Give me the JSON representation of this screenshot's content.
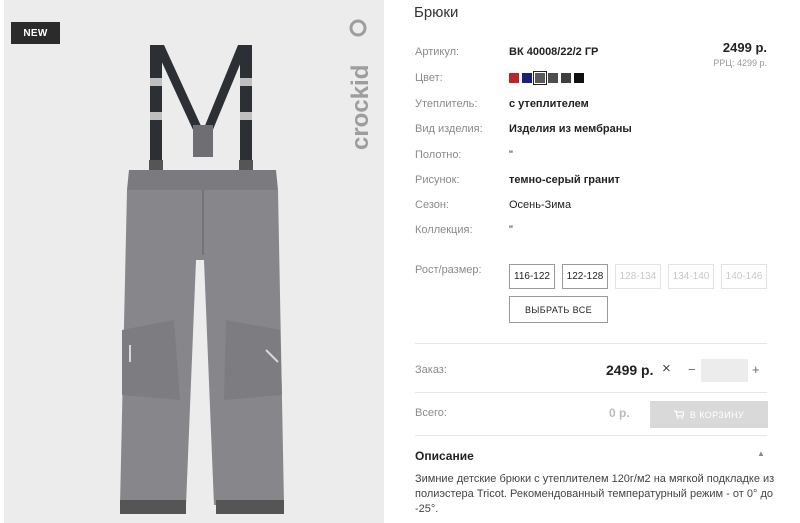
{
  "product": {
    "badge": "NEW",
    "brand": "crockid",
    "title": "Брюки"
  },
  "specs": {
    "article_label": "Артикул:",
    "article_value": "ВК 40008/22/2 ГР",
    "color_label": "Цвет:",
    "insulation_label": "Утеплитель:",
    "insulation_value": "с утеплителем",
    "type_label": "Вид изделия:",
    "type_value": "Изделия из мембраны",
    "fabric_label": "Полотно:",
    "fabric_value": "\"",
    "pattern_label": "Рисунок:",
    "pattern_value": "темно-серый гранит",
    "season_label": "Сезон:",
    "season_value": "Осень-Зима",
    "collection_label": "Коллекция:",
    "collection_value": "\"",
    "size_label": "Рост/размер:"
  },
  "price": {
    "main": "2499 р.",
    "rrp": "РРЦ: 4299 р."
  },
  "colors": [
    {
      "hex": "#c0242b",
      "selected": false
    },
    {
      "hex": "#1c1f7a",
      "selected": false
    },
    {
      "hex": "#5a5a5a",
      "selected": true
    },
    {
      "hex": "#4d4d4d",
      "selected": false
    },
    {
      "hex": "#3e3e3e",
      "selected": false
    },
    {
      "hex": "#111111",
      "selected": false
    }
  ],
  "sizes": [
    {
      "label": "116-122",
      "available": true
    },
    {
      "label": "122-128",
      "available": true
    },
    {
      "label": "128-134",
      "available": false
    },
    {
      "label": "134-140",
      "available": false
    },
    {
      "label": "140-146",
      "available": false
    }
  ],
  "select_all_label": "ВЫБРАТЬ ВСЕ",
  "order": {
    "label": "Заказ:",
    "price": "2499 р.",
    "times_icon": "×",
    "minus": "−",
    "plus": "+",
    "quantity": ""
  },
  "total": {
    "label": "Всего:",
    "value": "0 р.",
    "cart_button": "В КОРЗИНУ",
    "cart_icon": "cart-icon"
  },
  "description": {
    "title": "Описание",
    "text": "Зимние детские брюки с утеплителем 120г/м2 на мягкой подкладке из полиэстера Tricot. Рекомендованный температурный режим - от 0° до -25°."
  }
}
